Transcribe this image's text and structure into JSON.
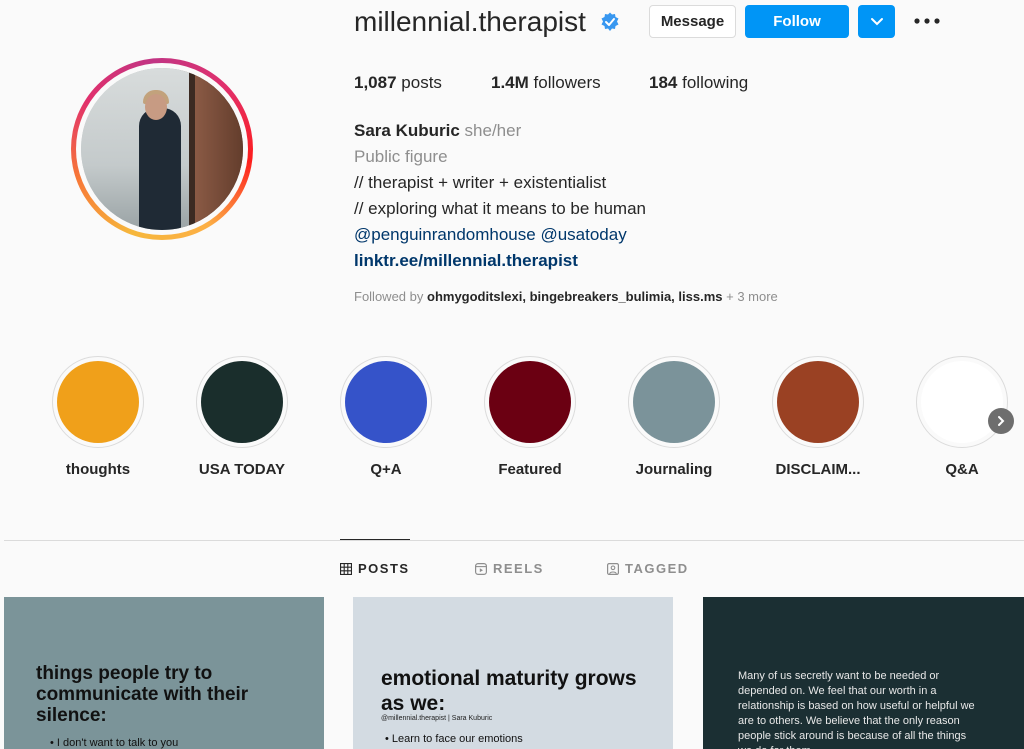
{
  "profile": {
    "username": "millennial.therapist",
    "verified_icon": "verified-badge-icon",
    "message_label": "Message",
    "follow_label": "Follow",
    "accent_color": "#0095f6"
  },
  "stats": {
    "posts_count": "1,087",
    "posts_label": "posts",
    "followers_count": "1.4M",
    "followers_label": "followers",
    "following_count": "184",
    "following_label": "following"
  },
  "bio": {
    "name": "Sara Kuburic",
    "pronouns": "she/her",
    "category": "Public figure",
    "line1": "// therapist + writer + existentialist",
    "line2": "// exploring what it means to be human",
    "mentions": "@penguinrandomhouse @usatoday",
    "link": "linktr.ee/millennial.therapist",
    "followed_prefix": "Followed by",
    "followed_names": "ohmygoditslexi, bingebreakers_bulimia, liss.ms",
    "followed_more": "+ 3 more"
  },
  "highlights": [
    {
      "label": "thoughts",
      "color": "#f0a01a"
    },
    {
      "label": "USA TODAY",
      "color": "#1a2e2c"
    },
    {
      "label": "Q+A",
      "color": "#3553c9"
    },
    {
      "label": "Featured",
      "color": "#6b0012"
    },
    {
      "label": "Journaling",
      "color": "#7b939a"
    },
    {
      "label": "DISCLAIM...",
      "color": "#9a4123"
    },
    {
      "label": "Q&A",
      "color": "#ffffff"
    }
  ],
  "tabs": {
    "posts": "POSTS",
    "reels": "REELS",
    "tagged": "TAGGED"
  },
  "posts": {
    "p1_title": "things people try to communicate with their silence:",
    "p1_item": "•   I don't want to talk to you",
    "p2_title": "emotional maturity grows as we:",
    "p2_sub": "@millennial.therapist | Sara Kuburic",
    "p2_item": "•   Learn to face our emotions",
    "p3_text": "Many of us secretly want to be needed or depended on. We feel that our worth in a relationship is based on how useful or helpful we are to others. We believe that the only reason people stick around is because of all the things we do for them."
  }
}
